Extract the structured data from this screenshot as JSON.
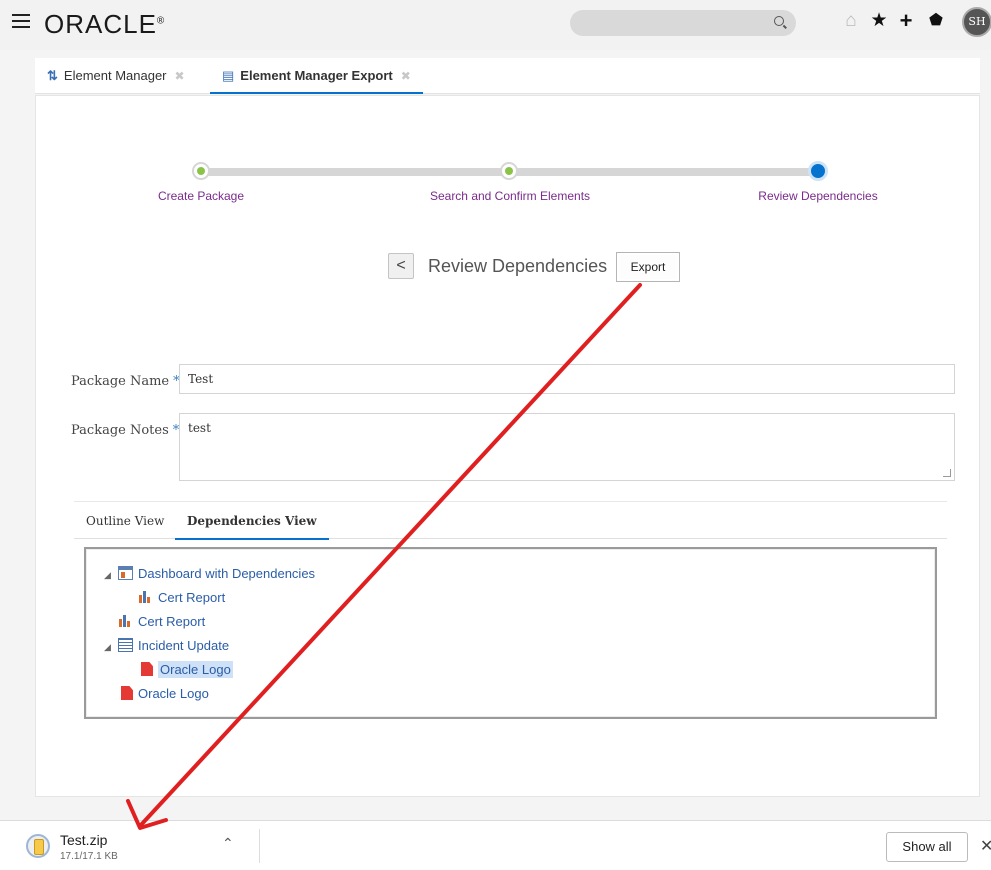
{
  "header": {
    "logo": "ORACLE",
    "logo_mark": "®",
    "avatar_initials": "SH",
    "icons": [
      "menu-icon",
      "search-icon",
      "home-icon",
      "star-icon",
      "plus-icon",
      "pin-icon"
    ]
  },
  "tabs": [
    {
      "label": "Element Manager",
      "icon": "sort-arrows-icon",
      "active": false
    },
    {
      "label": "Element Manager Export",
      "icon": "export-doc-icon",
      "active": true
    }
  ],
  "train": {
    "steps": [
      {
        "label": "Create Package",
        "state": "done"
      },
      {
        "label": "Search and Confirm Elements",
        "state": "done"
      },
      {
        "label": "Review Dependencies",
        "state": "current"
      }
    ]
  },
  "page": {
    "title": "Review Dependencies",
    "back_label": "<",
    "export_label": "Export"
  },
  "form": {
    "package_name_label": "Package Name",
    "package_name_value": "Test",
    "package_notes_label": "Package Notes",
    "package_notes_value": "test",
    "required_mark": "*"
  },
  "view_tabs": [
    {
      "label": "Outline View",
      "active": false
    },
    {
      "label": "Dependencies View",
      "active": true
    }
  ],
  "tree": [
    {
      "label": "Dashboard with Dependencies",
      "type": "dashboard",
      "expanded": true,
      "level": 0
    },
    {
      "label": "Cert Report",
      "type": "analysis",
      "level": 1
    },
    {
      "label": "Cert Report",
      "type": "analysis",
      "level": 0
    },
    {
      "label": "Incident Update",
      "type": "report",
      "expanded": true,
      "level": 0
    },
    {
      "label": "Oracle Logo",
      "type": "image",
      "level": 1,
      "selected": true
    },
    {
      "label": "Oracle Logo",
      "type": "image",
      "level": 0
    }
  ],
  "download": {
    "file_name": "Test.zip",
    "size": "17.1/17.1 KB",
    "show_all": "Show all",
    "close": "✕"
  },
  "colors": {
    "accent": "#0572ce",
    "train_label": "#7a2b8c",
    "tree_link": "#2a5da8",
    "annotation_arrow": "#e02020"
  }
}
